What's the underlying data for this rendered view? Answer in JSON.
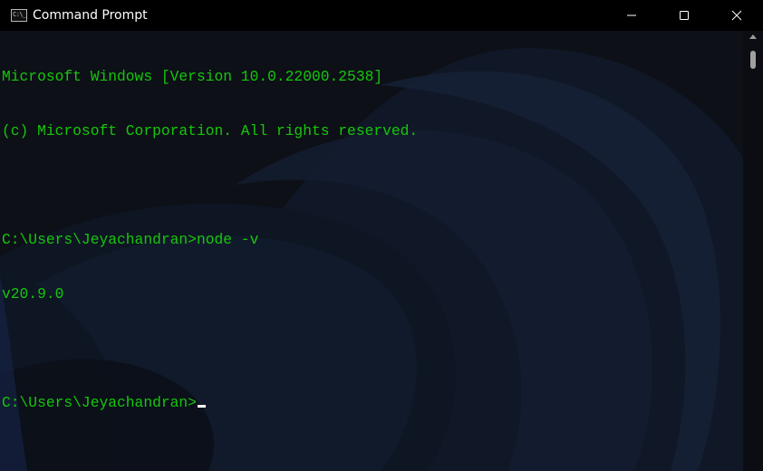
{
  "window": {
    "title": "Command Prompt",
    "app_icon_text": "C:\\_",
    "controls": [
      "minimize",
      "maximize",
      "close"
    ]
  },
  "console": {
    "text_color": "#16c60c",
    "lines": [
      "Microsoft Windows [Version 10.0.22000.2538]",
      "(c) Microsoft Corporation. All rights reserved.",
      "",
      "C:\\Users\\Jeyachandran>node -v",
      "v20.9.0",
      "",
      "C:\\Users\\Jeyachandran>"
    ]
  },
  "icons": {
    "minimize": "minimize-icon",
    "maximize": "maximize-icon",
    "close": "close-icon",
    "app": "cmd-app-icon"
  }
}
